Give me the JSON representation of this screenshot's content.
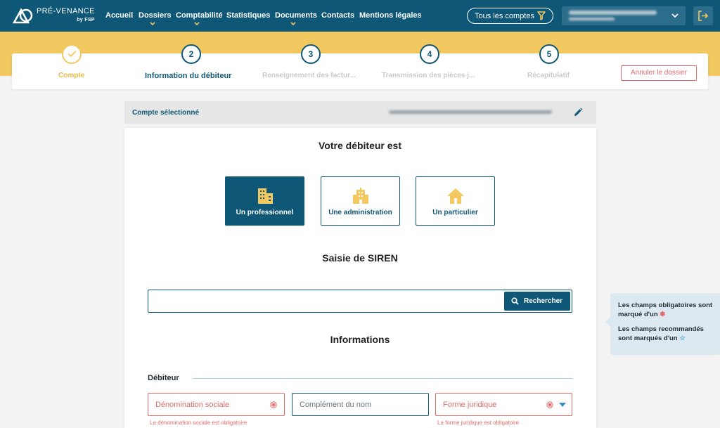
{
  "brand": {
    "name": "PRÉ-VENANCE",
    "sub": "by FSP"
  },
  "nav": {
    "items": [
      {
        "label": "Accueil",
        "has_menu": false
      },
      {
        "label": "Dossiers",
        "has_menu": true
      },
      {
        "label": "Comptabilité",
        "has_menu": true
      },
      {
        "label": "Statistiques",
        "has_menu": false
      },
      {
        "label": "Documents",
        "has_menu": true
      },
      {
        "label": "Contacts",
        "has_menu": false
      },
      {
        "label": "Mentions légales",
        "has_menu": false
      }
    ],
    "accounts_filter": "Tous les comptes"
  },
  "stepper": {
    "steps": [
      {
        "number": "",
        "label": "Compte",
        "state": "done"
      },
      {
        "number": "2",
        "label": "Information du débiteur",
        "state": "active"
      },
      {
        "number": "3",
        "label": "Renseignement des factur...",
        "state": "todo"
      },
      {
        "number": "4",
        "label": "Transmission des pièces j...",
        "state": "todo"
      },
      {
        "number": "5",
        "label": "Récapitulatif",
        "state": "todo"
      }
    ],
    "cancel_label": "Annuler le dossier"
  },
  "account": {
    "label": "Compte sélectionné"
  },
  "debtor": {
    "title": "Votre débiteur est",
    "types": [
      {
        "label": "Un professionnel",
        "icon": "building-icon",
        "selected": true
      },
      {
        "label": "Une administration",
        "icon": "administration-icon",
        "selected": false
      },
      {
        "label": "Un particulier",
        "icon": "house-icon",
        "selected": false
      }
    ]
  },
  "siren": {
    "title": "Saisie de SIREN",
    "value": "",
    "search_label": "Rechercher"
  },
  "info": {
    "title": "Informations",
    "section": "Débiteur",
    "fields": [
      {
        "placeholder": "Dénomination sociale",
        "required": true,
        "error": "La dénomination sociale est obligatoire"
      },
      {
        "placeholder": "Complément du nom",
        "required": false,
        "error": ""
      },
      {
        "placeholder": "Forme juridique",
        "required": true,
        "error": "La forme juridique est obligatoire"
      }
    ]
  },
  "hint": {
    "required": "Les champs obligatoires sont marqué d'un",
    "recommended": "Les champs recommandés sont marqués d'un"
  },
  "colors": {
    "primary": "#0e5777",
    "accent": "#f1c960",
    "error": "#e26b6b",
    "hint_bg": "#dce9f0"
  }
}
